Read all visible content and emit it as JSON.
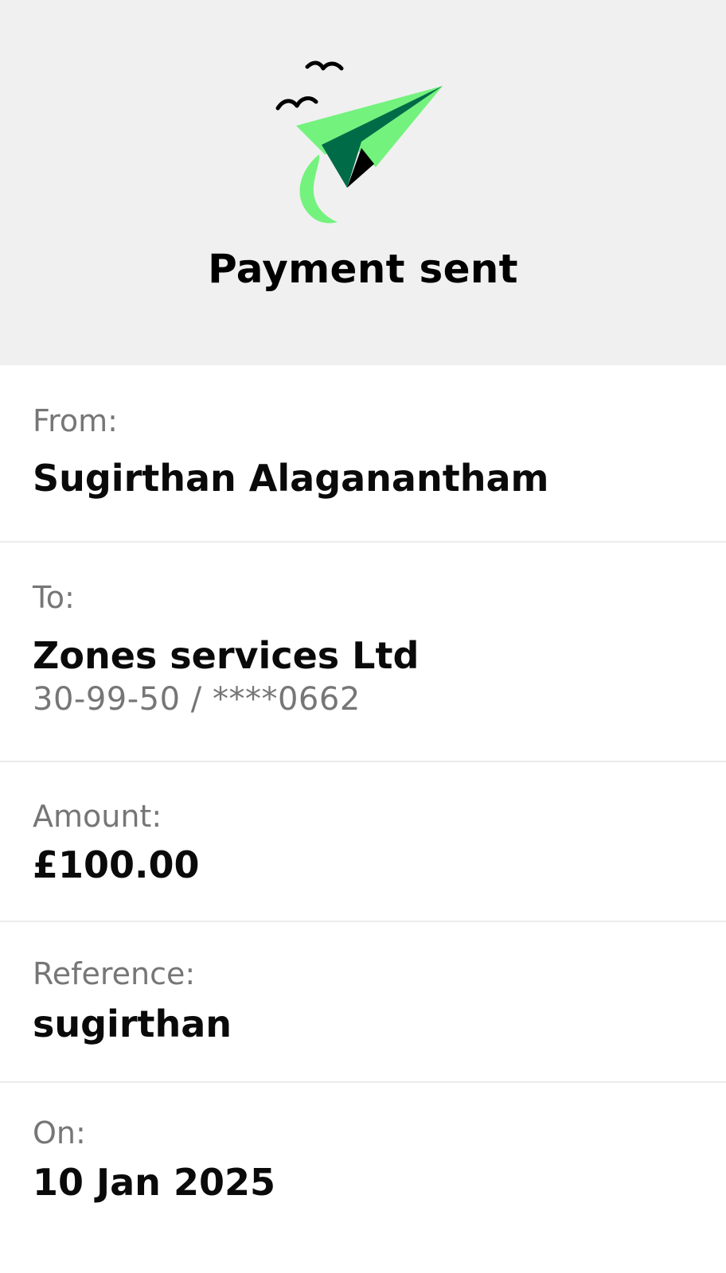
{
  "header": {
    "title": "Payment sent",
    "illustration": "paper-plane-icon",
    "background": "#f0f0f0",
    "accent_colors": [
      "#74f27e",
      "#006b47",
      "#000000"
    ]
  },
  "details": {
    "from": {
      "label": "From:",
      "value": "Sugirthan Alaganantham"
    },
    "to": {
      "label": "To:",
      "value": "Zones services Ltd",
      "account": "30-99-50 / ****0662"
    },
    "amount": {
      "label": "Amount:",
      "value": "£100.00"
    },
    "reference": {
      "label": "Reference:",
      "value": "sugirthan"
    },
    "on": {
      "label": "On:",
      "value": "10 Jan 2025"
    }
  }
}
